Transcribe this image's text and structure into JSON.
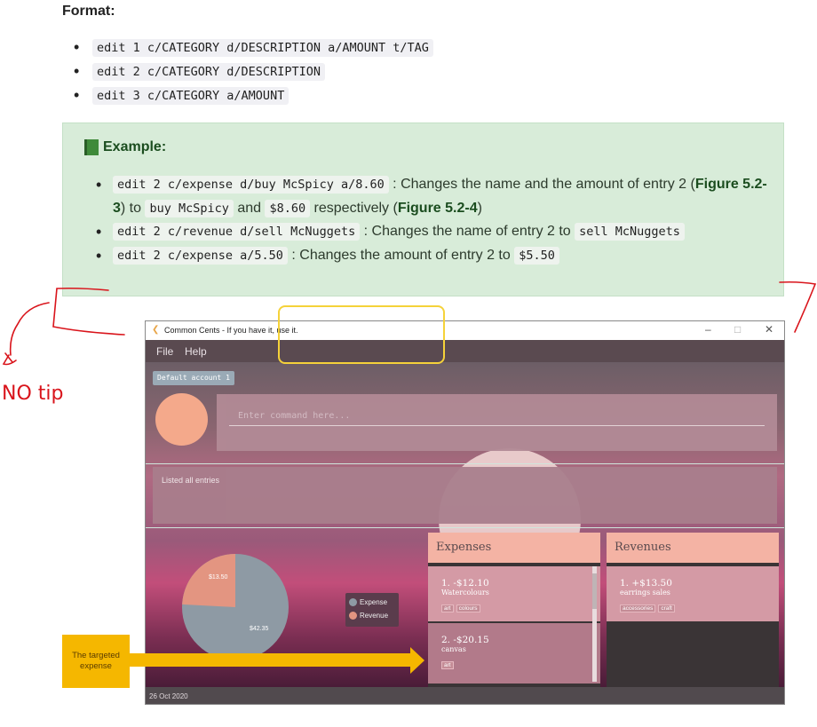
{
  "format": {
    "title": "Format:",
    "items": [
      "edit 1 c/CATEGORY d/DESCRIPTION a/AMOUNT t/TAG",
      "edit 2 c/CATEGORY d/DESCRIPTION",
      "edit 3 c/CATEGORY a/AMOUNT"
    ]
  },
  "example": {
    "title": "Example:",
    "items": [
      {
        "cmd": "edit 2 c/expense d/buy McSpicy a/8.60",
        "t1": " : Changes the name and the amount of entry 2 (",
        "fig1": "Figure 5.2-3",
        "t2": ") to ",
        "c2": "buy McSpicy",
        "t3": " and ",
        "c3": "$8.60",
        "t4": " respectively (",
        "fig2": "Figure 5.2-4",
        "t5": ")"
      },
      {
        "cmd": "edit 2 c/revenue d/sell McNuggets",
        "t1": " : Changes the name of entry 2 to ",
        "c2": "sell McNuggets"
      },
      {
        "cmd": "edit 2 c/expense a/5.50",
        "t1": " : Changes the amount of entry 2 to ",
        "c2": "$5.50"
      }
    ]
  },
  "app": {
    "window_title": "Common Cents - If you have it, use it.",
    "menu": [
      "File",
      "Help"
    ],
    "account": "Default account 1",
    "command_placeholder": "Enter command here...",
    "result": "Listed all entries",
    "pie": {
      "expense_label": "$42.35",
      "revenue_label": "$13.50",
      "expense_value": 42.35,
      "revenue_value": 13.5,
      "legend": [
        "Expense",
        "Revenue"
      ],
      "expense_color": "#8e9aa4",
      "revenue_color": "#e39581"
    },
    "expenses": {
      "title": "Expenses",
      "entries": [
        {
          "title": "1.  -$12.10",
          "desc": "Watercolours",
          "tags": [
            "art",
            "colours"
          ]
        },
        {
          "title": "2.  -$20.15",
          "desc": "canvas",
          "tags": [
            "art"
          ]
        }
      ]
    },
    "revenues": {
      "title": "Revenues",
      "entries": [
        {
          "title": "1.  +$13.50",
          "desc": "earrings sales",
          "tags": [
            "accessories",
            "craft"
          ]
        }
      ]
    },
    "status": "26 Oct 2020",
    "win_controls": [
      "–",
      "□",
      "✕"
    ]
  },
  "annotation": {
    "callout": "The targeted expense",
    "handwriting": "NO tip",
    "accent_color": "#f5b700",
    "ink_color": "#d9141b"
  }
}
